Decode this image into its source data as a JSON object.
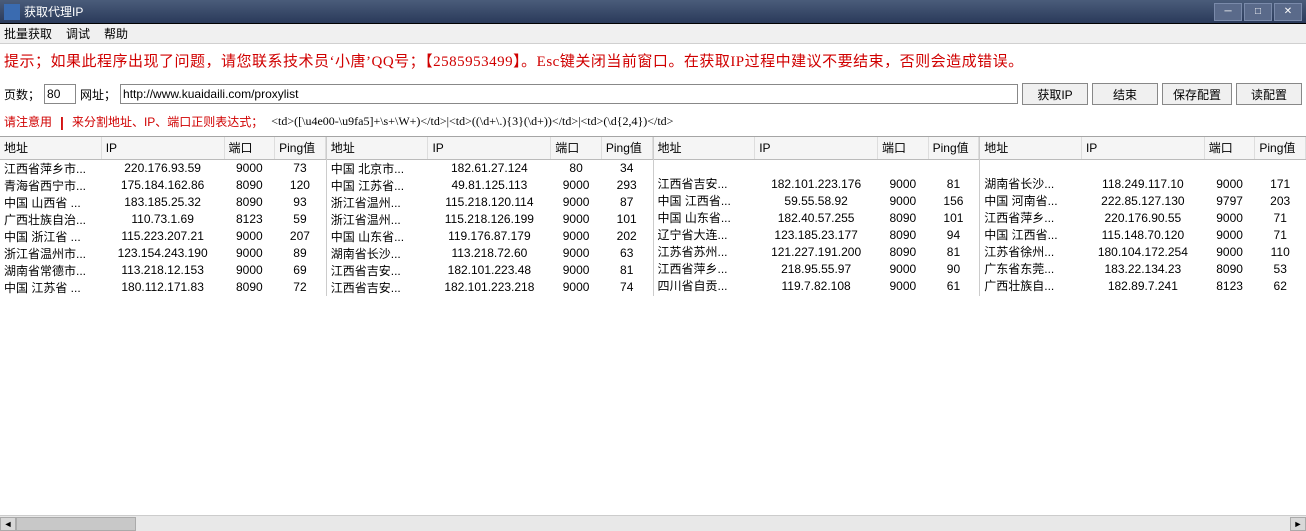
{
  "window": {
    "title": "获取代理IP"
  },
  "menu": {
    "batch": "批量获取",
    "debug": "调试",
    "help": "帮助"
  },
  "hint": "提示；如果此程序出现了问题，请您联系技术员‘小唐’QQ号；【2585953499】。Esc键关闭当前窗口。在获取IP过程中建议不要结束，否则会造成错误。",
  "form": {
    "pages_label": "页数；",
    "pages_value": "80",
    "url_label": "网址；",
    "url_value": "http://www.kuaidaili.com/proxylist",
    "btn_get": "获取IP",
    "btn_stop": "结束",
    "btn_save": "保存配置",
    "btn_read": "读配置"
  },
  "regexrow": {
    "attention": "请注意用",
    "sep": "|",
    "label": "来分割地址、IP、端口正则表达式；",
    "value": "<td>([\\u4e00-\\u9fa5]+\\s+\\W+)</td>|<td>((\\d+\\.){3}(\\d+))</td>|<td>(\\d{2,4})</td>"
  },
  "headers": {
    "addr": "地址",
    "ip": "IP",
    "port": "端口",
    "ping": "Ping值"
  },
  "tables": [
    [
      {
        "addr": "江西省萍乡市...",
        "ip": "220.176.93.59",
        "port": "9000",
        "ping": "73"
      },
      {
        "addr": "青海省西宁市...",
        "ip": "175.184.162.86",
        "port": "8090",
        "ping": "120"
      },
      {
        "addr": "中国 山西省 ...",
        "ip": "183.185.25.32",
        "port": "8090",
        "ping": "93"
      },
      {
        "addr": "广西壮族自治...",
        "ip": "110.73.1.69",
        "port": "8123",
        "ping": "59"
      },
      {
        "addr": "中国 浙江省 ...",
        "ip": "115.223.207.21",
        "port": "9000",
        "ping": "207"
      },
      {
        "addr": "浙江省温州市...",
        "ip": "123.154.243.190",
        "port": "9000",
        "ping": "89"
      },
      {
        "addr": "湖南省常德市...",
        "ip": "113.218.12.153",
        "port": "9000",
        "ping": "69"
      },
      {
        "addr": "中国 江苏省 ...",
        "ip": "180.112.171.83",
        "port": "8090",
        "ping": "72"
      }
    ],
    [
      {
        "addr": "中国 北京市...",
        "ip": "182.61.27.124",
        "port": "80",
        "ping": "34"
      },
      {
        "addr": "中国 江苏省...",
        "ip": "49.81.125.113",
        "port": "9000",
        "ping": "293"
      },
      {
        "addr": "浙江省温州...",
        "ip": "115.218.120.114",
        "port": "9000",
        "ping": "87"
      },
      {
        "addr": "浙江省温州...",
        "ip": "115.218.126.199",
        "port": "9000",
        "ping": "101"
      },
      {
        "addr": "中国 山东省...",
        "ip": "119.176.87.179",
        "port": "9000",
        "ping": "202"
      },
      {
        "addr": "湖南省长沙...",
        "ip": "113.218.72.60",
        "port": "9000",
        "ping": "63"
      },
      {
        "addr": "江西省吉安...",
        "ip": "182.101.223.48",
        "port": "9000",
        "ping": "81"
      },
      {
        "addr": "江西省吉安...",
        "ip": "182.101.223.218",
        "port": "9000",
        "ping": "74"
      }
    ],
    [
      {
        "addr": "",
        "ip": "",
        "port": "",
        "ping": ""
      },
      {
        "addr": "江西省吉安...",
        "ip": "182.101.223.176",
        "port": "9000",
        "ping": "81"
      },
      {
        "addr": "中国 江西省...",
        "ip": "59.55.58.92",
        "port": "9000",
        "ping": "156"
      },
      {
        "addr": "中国 山东省...",
        "ip": "182.40.57.255",
        "port": "8090",
        "ping": "101"
      },
      {
        "addr": "辽宁省大连...",
        "ip": "123.185.23.177",
        "port": "8090",
        "ping": "94"
      },
      {
        "addr": "江苏省苏州...",
        "ip": "121.227.191.200",
        "port": "8090",
        "ping": "81"
      },
      {
        "addr": "江西省萍乡...",
        "ip": "218.95.55.97",
        "port": "9000",
        "ping": "90"
      },
      {
        "addr": "四川省自贡...",
        "ip": "119.7.82.108",
        "port": "9000",
        "ping": "61"
      }
    ],
    [
      {
        "addr": "",
        "ip": "",
        "port": "",
        "ping": ""
      },
      {
        "addr": "湖南省长沙...",
        "ip": "118.249.117.10",
        "port": "9000",
        "ping": "171"
      },
      {
        "addr": "中国 河南省...",
        "ip": "222.85.127.130",
        "port": "9797",
        "ping": "203"
      },
      {
        "addr": "江西省萍乡...",
        "ip": "220.176.90.55",
        "port": "9000",
        "ping": "71"
      },
      {
        "addr": "中国 江西省...",
        "ip": "115.148.70.120",
        "port": "9000",
        "ping": "71"
      },
      {
        "addr": "江苏省徐州...",
        "ip": "180.104.172.254",
        "port": "9000",
        "ping": "110"
      },
      {
        "addr": "广东省东莞...",
        "ip": "183.22.134.23",
        "port": "8090",
        "ping": "53"
      },
      {
        "addr": "广西壮族自...",
        "ip": "182.89.7.241",
        "port": "8123",
        "ping": "62"
      }
    ]
  ]
}
